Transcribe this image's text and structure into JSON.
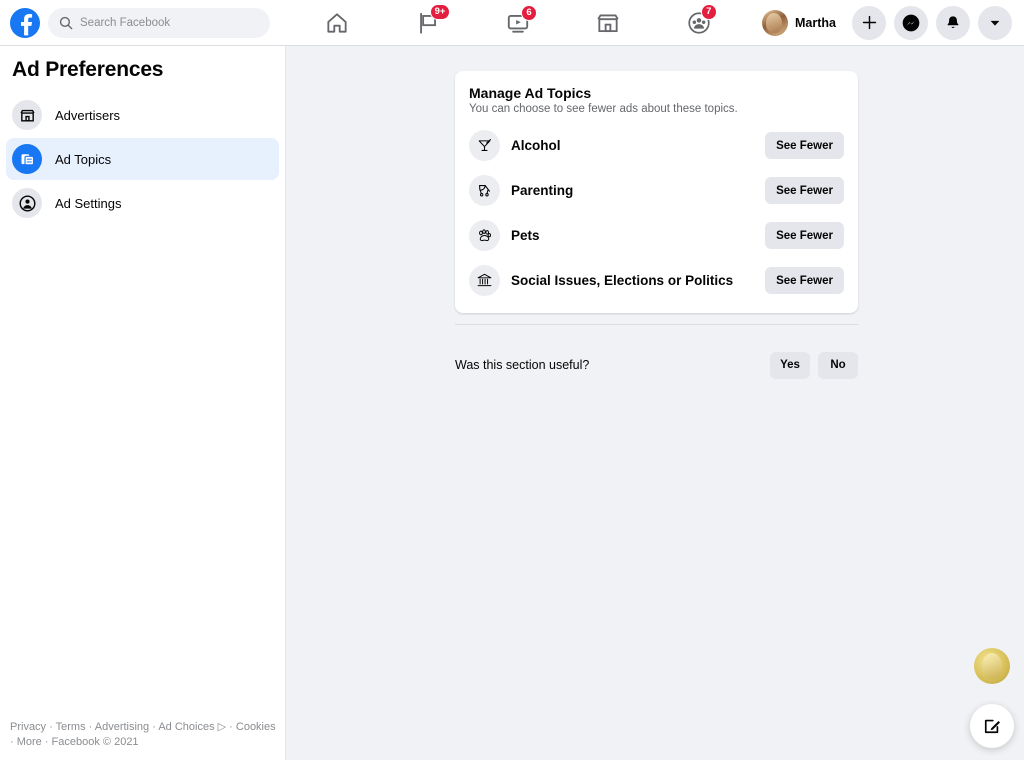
{
  "header": {
    "logo_icon": "facebook-logo-icon",
    "search": {
      "icon": "search-icon",
      "placeholder": "Search Facebook",
      "value": "Search Facebook"
    },
    "nav": [
      {
        "name": "home",
        "icon": "home-icon",
        "badge": ""
      },
      {
        "name": "pages",
        "icon": "flag-icon",
        "badge": "9+"
      },
      {
        "name": "watch",
        "icon": "video-screen-icon",
        "badge": "6"
      },
      {
        "name": "marketplace",
        "icon": "storefront-icon",
        "badge": ""
      },
      {
        "name": "groups",
        "icon": "groups-icon",
        "badge": "7"
      }
    ],
    "profile": {
      "name": "Martha",
      "avatar_icon": "avatar"
    },
    "actions": [
      {
        "name": "create",
        "icon": "plus-icon"
      },
      {
        "name": "messenger",
        "icon": "messenger-icon"
      },
      {
        "name": "notifications",
        "icon": "bell-icon"
      },
      {
        "name": "account-menu",
        "icon": "chevron-down-icon"
      }
    ]
  },
  "sidebar": {
    "title": "Ad Preferences",
    "items": [
      {
        "label": "Advertisers",
        "icon": "storefront-icon",
        "active": false
      },
      {
        "label": "Ad Topics",
        "icon": "stacked-cards-icon",
        "active": true
      },
      {
        "label": "Ad Settings",
        "icon": "account-circle-icon",
        "active": false
      }
    ],
    "footer": "Privacy · Terms · Advertising · Ad Choices ▷ · Cookies · More · Facebook © 2021"
  },
  "main": {
    "card": {
      "title": "Manage Ad Topics",
      "subtitle": "You can choose to see fewer ads about these topics.",
      "topics": [
        {
          "label": "Alcohol",
          "icon": "cocktail-glass-icon",
          "action": "See Fewer"
        },
        {
          "label": "Parenting",
          "icon": "stroller-icon",
          "action": "See Fewer"
        },
        {
          "label": "Pets",
          "icon": "paw-print-icon",
          "action": "See Fewer"
        },
        {
          "label": "Social Issues, Elections or Politics",
          "icon": "bank-building-icon",
          "action": "See Fewer"
        }
      ]
    },
    "feedback": {
      "question": "Was this section useful?",
      "yes_label": "Yes",
      "no_label": "No"
    }
  },
  "floating": {
    "avatar_icon": "avatar",
    "compose_icon": "compose-pencil-icon"
  },
  "colors": {
    "brand_blue": "#1877F2",
    "active_bg": "#E7F0FD",
    "page_bg": "#F0F2F5",
    "badge_red": "#E41E3F",
    "button_gray": "#E4E6EB"
  }
}
